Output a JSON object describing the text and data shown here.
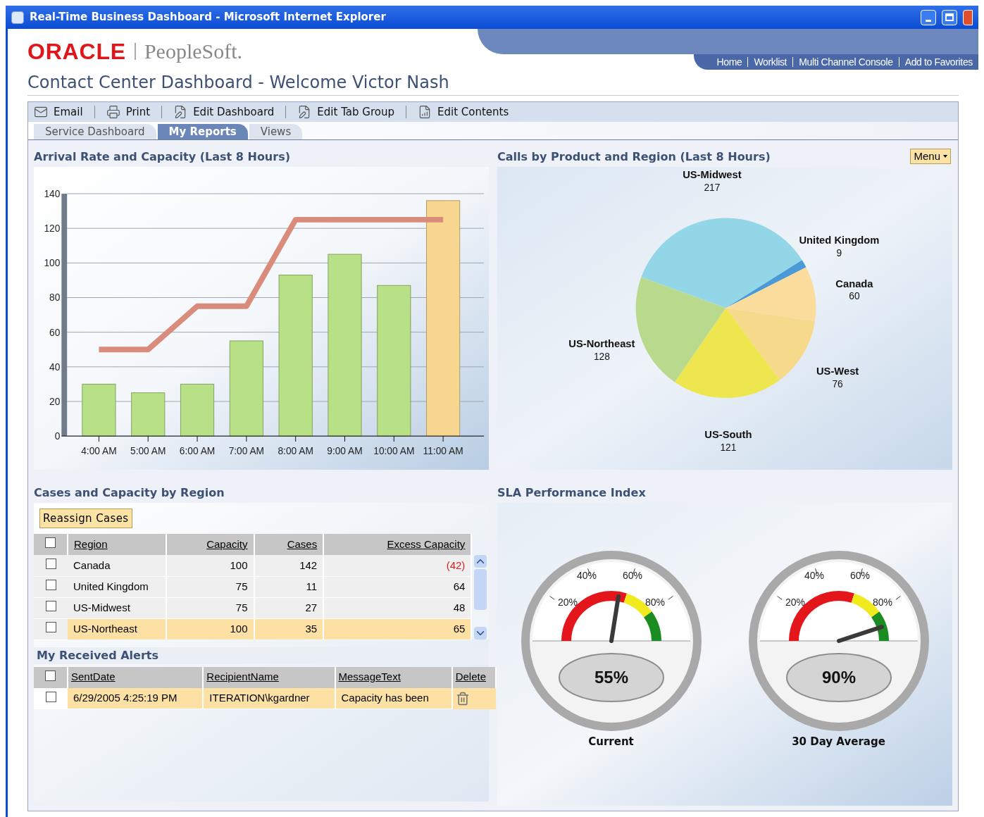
{
  "window": {
    "title": "Real-Time Business Dashboard - Microsoft Internet Explorer"
  },
  "header": {
    "logo_brand": "ORACLE",
    "logo_product": "PeopleSoft.",
    "page_title": "Contact Center Dashboard - Welcome Victor Nash",
    "links": [
      "Home",
      "Worklist",
      "Multi Channel Console",
      "Add to Favorites"
    ]
  },
  "toolbar": [
    "Email",
    "Print",
    "Edit Dashboard",
    "Edit Tab Group",
    "Edit Contents"
  ],
  "tabs": [
    {
      "label": "Service Dashboard",
      "selected": false
    },
    {
      "label": "My Reports",
      "selected": true
    },
    {
      "label": "Views",
      "selected": false
    }
  ],
  "arrival_panel": {
    "title": "Arrival Rate and Capacity (Last 8 Hours)",
    "chart_data": {
      "type": "bar",
      "grid": true,
      "categories": [
        "4:00 AM",
        "5:00 AM",
        "6:00 AM",
        "7:00 AM",
        "8:00 AM",
        "9:00 AM",
        "10:00 AM",
        "11:00 AM"
      ],
      "series": [
        {
          "type": "bar",
          "color": "#b8e086",
          "colors": [
            null,
            null,
            null,
            null,
            null,
            null,
            null,
            "#f7d690"
          ],
          "values": [
            30,
            25,
            30,
            55,
            93,
            105,
            87,
            136
          ]
        },
        {
          "type": "line",
          "color": "#d98b7c",
          "values": [
            50,
            50,
            75,
            75,
            125,
            125,
            125,
            125
          ]
        }
      ],
      "ylim": [
        0,
        140
      ],
      "yticks": [
        0,
        20,
        40,
        60,
        80,
        100,
        120,
        140
      ]
    }
  },
  "calls_panel": {
    "title": "Calls by Product and Region (Last 8 Hours)",
    "menu": "Menu",
    "chart_data": {
      "type": "pie",
      "categories": [
        "US-Midwest",
        "United Kingdom",
        "Canada",
        "US-West",
        "US-South",
        "US-Northeast"
      ],
      "series": [
        {
          "colors": [
            "#93d6e8",
            "#4a9ad6",
            "#fcdc9c",
            "#f6d98a",
            "#ede64e",
            "#b9d98c"
          ],
          "values": [
            217,
            9,
            60,
            76,
            121,
            128
          ]
        }
      ],
      "data_labels": true
    }
  },
  "cases_panel": {
    "title": "Cases and Capacity by Region",
    "button": "Reassign Cases",
    "header_checked": false,
    "columns": [
      "Region",
      "Capacity",
      "Cases",
      "Excess Capacity"
    ],
    "rows": [
      {
        "region": "Canada",
        "capacity": "100",
        "cases": "142",
        "excess": "(42)",
        "negative": true,
        "checked": false,
        "selected": false
      },
      {
        "region": "United Kingdom",
        "capacity": "75",
        "cases": "11",
        "excess": "64",
        "negative": false,
        "checked": false,
        "selected": false
      },
      {
        "region": "US-Midwest",
        "capacity": "75",
        "cases": "27",
        "excess": "48",
        "negative": false,
        "checked": false,
        "selected": false
      },
      {
        "region": "US-Northeast",
        "capacity": "100",
        "cases": "35",
        "excess": "65",
        "negative": false,
        "checked": false,
        "selected": true
      }
    ]
  },
  "alerts_panel": {
    "title": "My Received Alerts",
    "header_checked": false,
    "columns": [
      "SentDate",
      "RecipientName",
      "MessageText",
      "Delete"
    ],
    "rows": [
      {
        "sent": "6/29/2005 4:25:19 PM",
        "recipient": "ITERATION\\kgardner",
        "message": "Capacity has been",
        "checked": false,
        "selected": true
      }
    ]
  },
  "sla_panel": {
    "title": "SLA Performance Index",
    "gauges": [
      {
        "ticks": [
          "20%",
          "40%",
          "60%",
          "80%"
        ],
        "reading": "55%",
        "caption": "Current",
        "level": 0.55
      },
      {
        "ticks": [
          "20%",
          "40%",
          "60%",
          "80%"
        ],
        "reading": "90%",
        "caption": "30 Day Average",
        "level": 0.9
      }
    ]
  }
}
